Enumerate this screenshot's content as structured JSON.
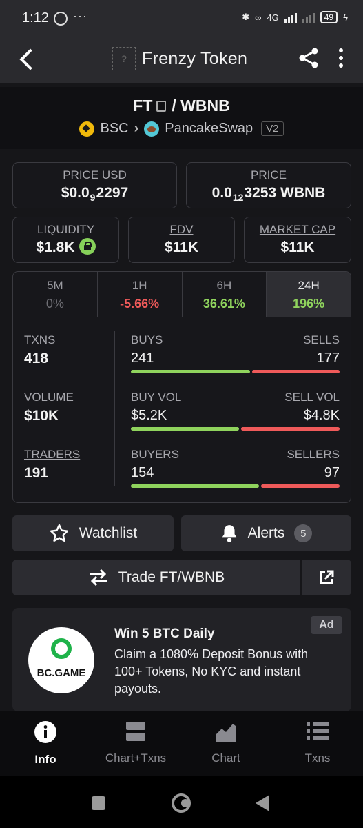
{
  "status": {
    "time": "1:12",
    "dots": "···",
    "network": "4G",
    "battery": "49"
  },
  "header": {
    "title": "Frenzy Token",
    "placeholder_icon": "?"
  },
  "pair": {
    "base": "FT",
    "sep": "/",
    "quote": "WBNB",
    "chain": "BSC",
    "dex": "PancakeSwap",
    "version": "V2"
  },
  "price_usd": {
    "label": "PRICE USD",
    "pre": "$0.0",
    "sub": "9",
    "post": "2297"
  },
  "price_native": {
    "label": "PRICE",
    "pre": "0.0",
    "sub": "12",
    "post": "3253 WBNB"
  },
  "liquidity": {
    "label": "LIQUIDITY",
    "value": "$1.8K"
  },
  "fdv": {
    "label": "FDV",
    "value": "$11K"
  },
  "market_cap": {
    "label": "MARKET CAP",
    "value": "$11K"
  },
  "tabs": [
    {
      "label": "5M",
      "value": "0%"
    },
    {
      "label": "1H",
      "value": "-5.66%"
    },
    {
      "label": "6H",
      "value": "36.61%"
    },
    {
      "label": "24H",
      "value": "196%"
    }
  ],
  "stats": {
    "txns": {
      "label": "TXNS",
      "value": "418",
      "left_label": "BUYS",
      "left_value": "241",
      "right_label": "SELLS",
      "right_value": "177"
    },
    "volume": {
      "label": "VOLUME",
      "value": "$10K",
      "left_label": "BUY VOL",
      "left_value": "$5.2K",
      "right_label": "SELL VOL",
      "right_value": "$4.8K"
    },
    "traders": {
      "label": "TRADERS",
      "value": "191",
      "left_label": "BUYERS",
      "left_value": "154",
      "right_label": "SELLERS",
      "right_value": "97"
    }
  },
  "actions": {
    "watchlist": "Watchlist",
    "alerts": "Alerts",
    "alerts_count": "5",
    "trade": "Trade FT/WBNB"
  },
  "ad": {
    "tag": "Ad",
    "brand": "BC.GAME",
    "title": "Win 5 BTC Daily",
    "body": "Claim a 1080% Deposit Bonus with 100+ Tokens, No KYC and instant payouts."
  },
  "nav": [
    {
      "label": "Info",
      "icon": "info-icon"
    },
    {
      "label": "Chart+Txns",
      "icon": "split-view-icon"
    },
    {
      "label": "Chart",
      "icon": "area-chart-icon"
    },
    {
      "label": "Txns",
      "icon": "list-icon"
    }
  ],
  "colors": {
    "positive": "#8fd35d",
    "negative": "#ef5a5a",
    "background": "#161619"
  }
}
